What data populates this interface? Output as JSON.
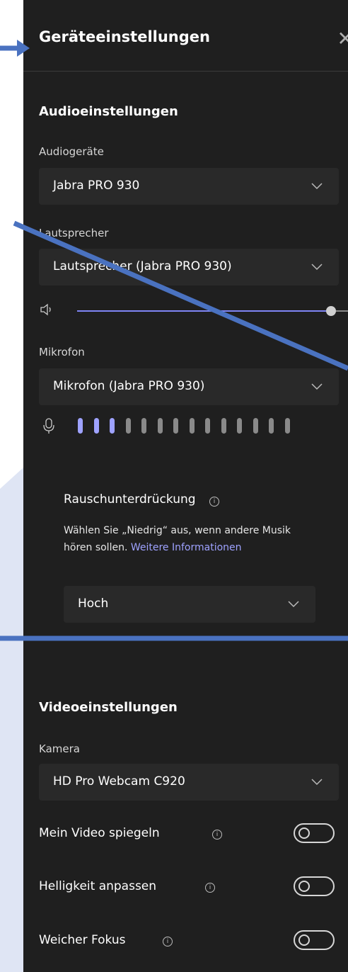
{
  "header": {
    "title": "Geräteeinstellungen",
    "close_icon": "close-icon"
  },
  "audio": {
    "section_title": "Audioeinstellungen",
    "devices_label": "Audiogeräte",
    "devices_value": "Jabra PRO 930",
    "speaker_label": "Lautsprecher",
    "speaker_value": "Lautsprecher (Jabra PRO 930)",
    "volume_level": 0.97,
    "mic_label": "Mikrofon",
    "mic_value": "Mikrofon (Jabra PRO 930)",
    "mic_level_bars_active": 3,
    "mic_level_bars_total": 14
  },
  "noise": {
    "title": "Rauschunterdrückung",
    "description": "Wählen Sie „Niedrig“ aus, wenn andere Musik hören sollen.",
    "link": "Weitere Informationen",
    "value": "Hoch"
  },
  "video": {
    "section_title": "Videoeinstellungen",
    "camera_label": "Kamera",
    "camera_value": "HD Pro Webcam C920",
    "toggles": [
      {
        "label": "Mein Video spiegeln",
        "on": false
      },
      {
        "label": "Helligkeit anpassen",
        "on": false
      },
      {
        "label": "Weicher Fokus",
        "on": false
      }
    ]
  },
  "colors": {
    "panel": "#1f1f1f",
    "accent": "#9ea2ff",
    "annotation": "#4a72c0"
  }
}
